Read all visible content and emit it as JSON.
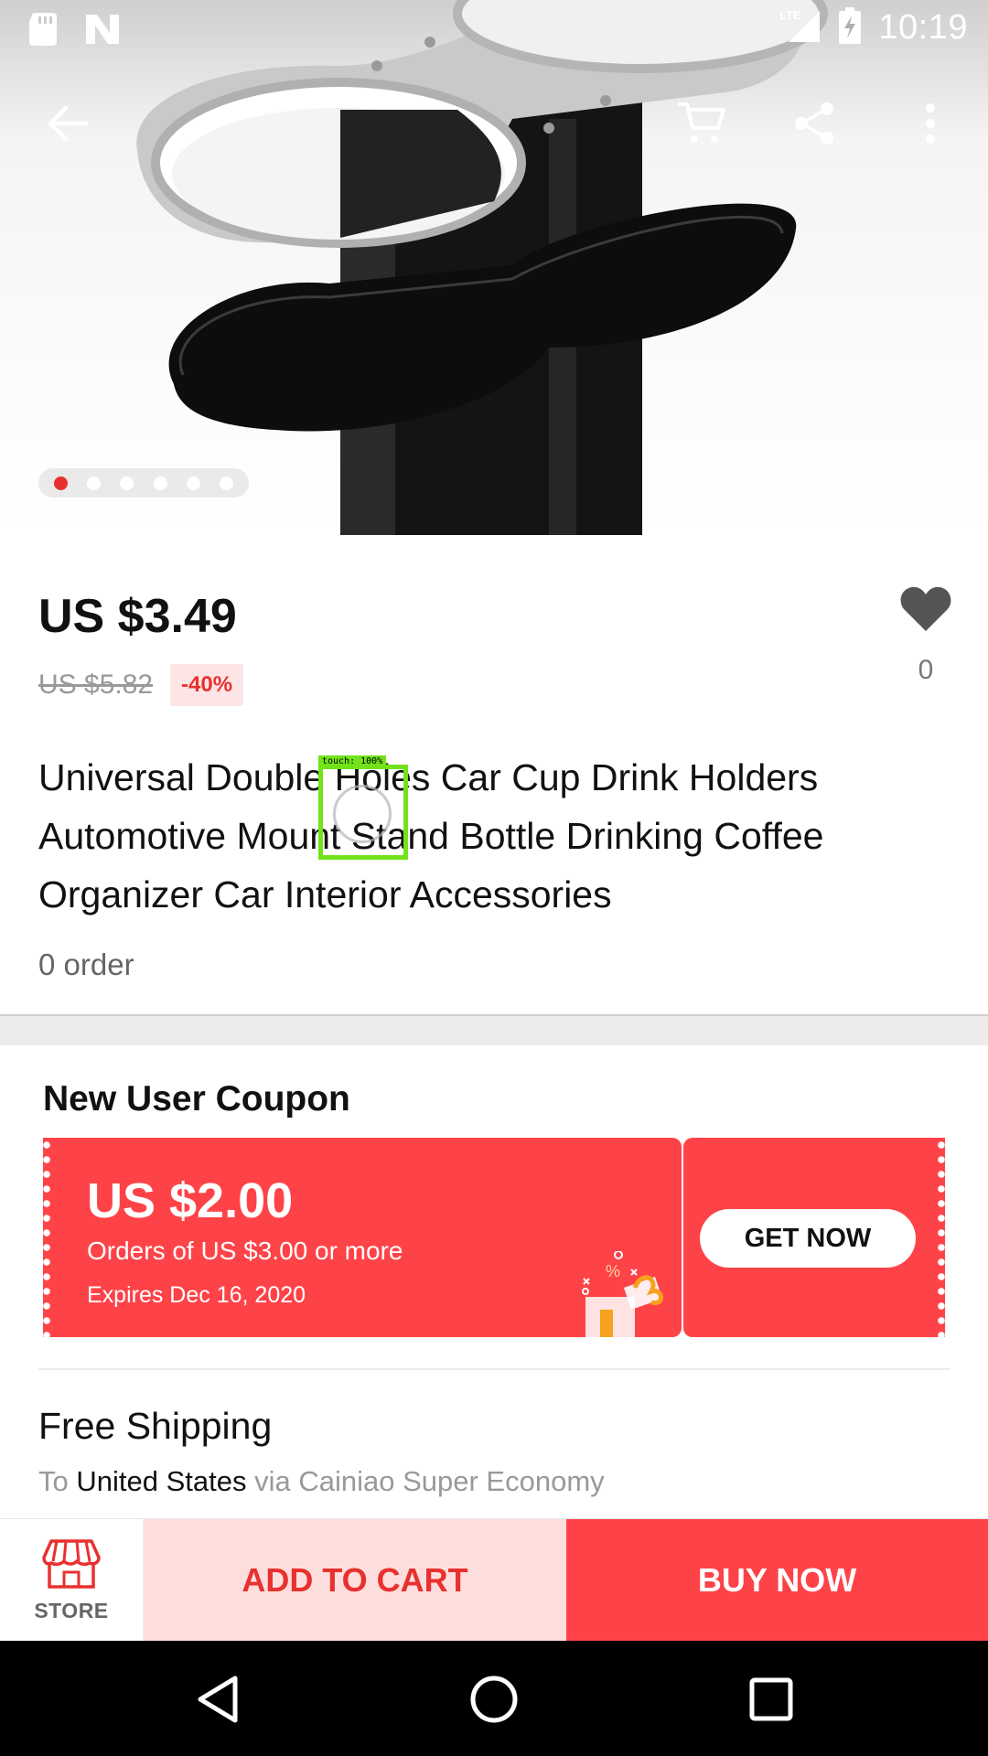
{
  "status_bar": {
    "time": "10:19",
    "network": "LTE",
    "icons": [
      "sd-card-icon",
      "n-icon",
      "signal-icon",
      "battery-charging-icon"
    ]
  },
  "top_bar": {
    "icons": [
      "back-arrow-icon",
      "cart-icon",
      "share-icon",
      "more-vert-icon"
    ]
  },
  "gallery": {
    "image_count": 6,
    "active_index": 0
  },
  "product": {
    "price": "US $3.49",
    "original_price": "US $5.82",
    "discount": "-40%",
    "wishlist_count": "0",
    "title": "Universal Double Holes Car Cup Drink Holders Automotive Mount Stand Bottle Drinking Coffee Organizer Car Interior Accessories",
    "orders": "0 order"
  },
  "touch_indicator": {
    "label": "touch: 100%"
  },
  "coupon": {
    "heading": "New User Coupon",
    "amount": "US $2.00",
    "condition": "Orders of US $3.00 or more",
    "expires": "Expires Dec 16, 2020",
    "button": "GET NOW",
    "color": "#fe4348"
  },
  "shipping": {
    "title": "Free Shipping",
    "prefix": "To",
    "country": "United States",
    "suffix": "via Cainiao Super Economy"
  },
  "action_bar": {
    "store_label": "STORE",
    "add_to_cart": "ADD TO CART",
    "buy_now": "BUY NOW",
    "accent": "#e8312f"
  },
  "nav_bar": {
    "icons": [
      "nav-back-icon",
      "nav-home-icon",
      "nav-recents-icon"
    ]
  }
}
